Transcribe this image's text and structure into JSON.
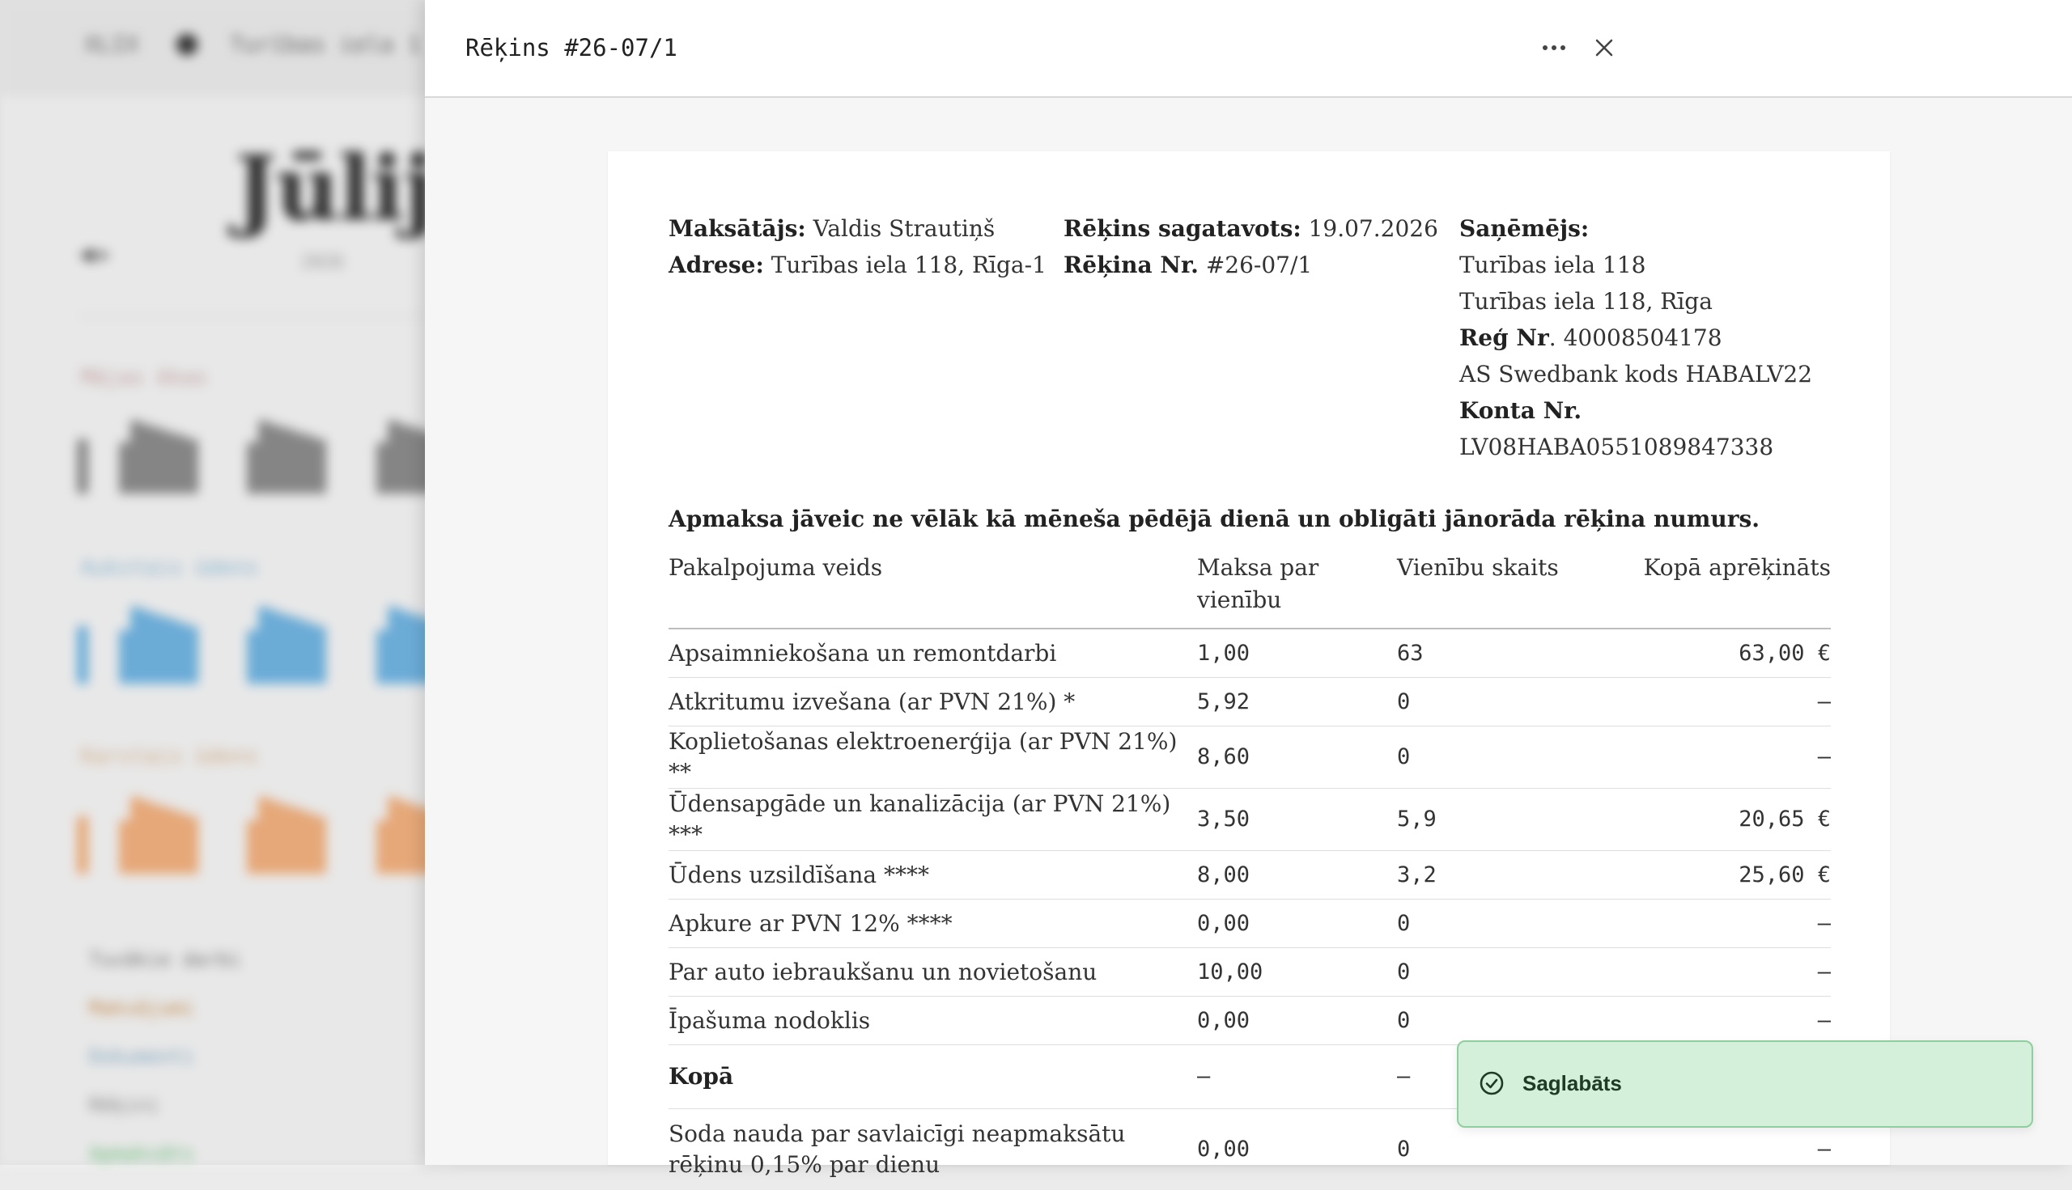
{
  "colors": {
    "accent_green": "#d4efda",
    "toast_border": "#8fcf9f",
    "bg_blue": "#5aa9dd",
    "bg_orange": "#f0a46a",
    "bg_gray": "#7a7a7a"
  },
  "background": {
    "topbar_text_1": "XLIX",
    "topbar_text_2": "Turības iela 1",
    "month_title": "Jūlijs",
    "year": "2026",
    "nav": "◀ ▸",
    "sections": [
      "Mājas ēkas",
      "Aukstais ūdens",
      "Karstais ūdens"
    ],
    "list_items": [
      "Tuvākie darbi",
      "Maksājumi",
      "Dokumenti",
      "Rēķini",
      "Apmaksāts"
    ]
  },
  "panel": {
    "title": "Rēķins #26-07/1",
    "more_icon": "more-horizontal-icon",
    "close_icon": "close-icon"
  },
  "invoice": {
    "payer_label": "Maksātājs:",
    "payer_value": "Valdis Strautiņš",
    "address_label": "Adrese:",
    "address_value": "Turības iela 118, Rīga-1",
    "prepared_label": "Rēķins sagatavots:",
    "prepared_value": "19.07.2026",
    "number_label": "Rēķina Nr.",
    "number_value": "#26-07/1",
    "recipient_label": "Saņēmējs:",
    "recipient_line1": "Turības iela 118",
    "recipient_line2": "Turības iela 118, Rīga",
    "reg_label": "Reģ Nr",
    "reg_value": ". 40008504178",
    "bank_line": "AS Swedbank kods HABALV22",
    "account_label": "Konta Nr.",
    "account_value": "LV08HABA0551089847338",
    "notice": "Apmaksa jāveic ne vēlāk kā mēneša pēdējā dienā un obligāti jānorāda rēķina numurs.",
    "table": {
      "headers": [
        "Pakalpojuma veids",
        "Maksa par vienību",
        "Vienību skaits",
        "Kopā aprēķināts"
      ],
      "rows": [
        [
          "Apsaimniekošana un remontdarbi",
          "1,00",
          "63",
          "63,00 €"
        ],
        [
          "Atkritumu izvešana (ar PVN 21%) *",
          "5,92",
          "0",
          "—"
        ],
        [
          "Koplietošanas elektroenerģija (ar PVN 21%) **",
          "8,60",
          "0",
          "—"
        ],
        [
          "Ūdensapgāde un kanalizācija (ar PVN 21%) ***",
          "3,50",
          "5,9",
          "20,65 €"
        ],
        [
          "Ūdens uzsildīšana ****",
          "8,00",
          "3,2",
          "25,60 €"
        ],
        [
          "Apkure ar PVN 12% ****",
          "0,00",
          "0",
          "—"
        ],
        [
          "Par auto iebraukšanu un novietošanu",
          "10,00",
          "0",
          "—"
        ],
        [
          "Īpašuma nodoklis",
          "0,00",
          "0",
          "—"
        ]
      ],
      "total": [
        "Kopā",
        "—",
        "—",
        ""
      ],
      "penalty": [
        "Soda nauda par savlaicīgi neapmaksātu rēķinu 0,15% par dienu",
        "0,00",
        "0",
        "—"
      ]
    }
  },
  "toast": {
    "text": "Saglabāts",
    "icon": "check-circle-icon"
  }
}
